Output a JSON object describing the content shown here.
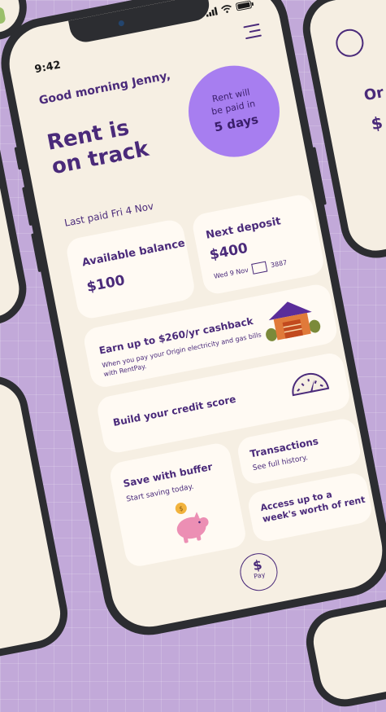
{
  "status": {
    "time": "9:42"
  },
  "home": {
    "greeting": "Good morning Jenny,",
    "title_line1": "Rent is",
    "title_line2": "on track",
    "badge_line1": "Rent will",
    "badge_line2": "be paid in",
    "badge_days": "5 days",
    "last_paid": "Last paid Fri 4 Nov"
  },
  "balance": {
    "label": "Available balance",
    "value": "$100"
  },
  "deposit": {
    "label": "Next deposit",
    "value": "$400",
    "date": "Wed 9 Nov",
    "account": "3887"
  },
  "cashback": {
    "title": "Earn up to $260/yr cashback",
    "description": "When you pay your Origin electricity and gas bills with RentPay."
  },
  "credit": {
    "title": "Build your credit score"
  },
  "buffer": {
    "title": "Save with buffer",
    "subtitle": "Start saving today."
  },
  "transactions": {
    "title": "Transactions",
    "subtitle": "See full history."
  },
  "access": {
    "title": "Access up to a week's worth of rent"
  },
  "pay": {
    "icon": "$",
    "label": "Pay"
  },
  "background": {
    "right_phone_text1": "Or",
    "right_phone_text2": "$"
  },
  "colors": {
    "accent": "#4a2a7a",
    "badge": "#a77ef0",
    "background": "#c2a9d9",
    "card": "#fffaf3"
  }
}
